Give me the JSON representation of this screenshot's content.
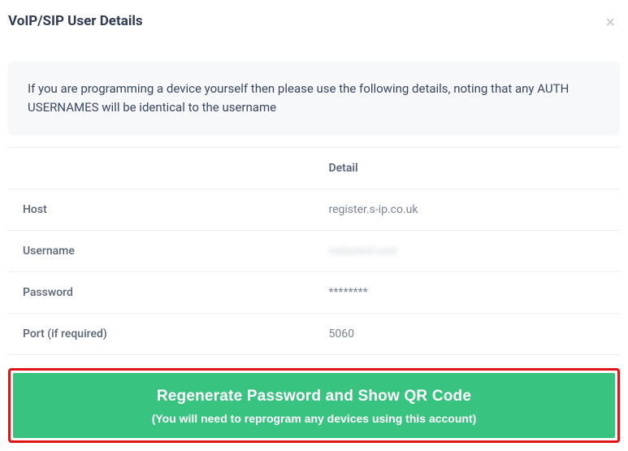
{
  "modal": {
    "title": "VoIP/SIP User Details",
    "close_label": "×"
  },
  "info": {
    "text": "If you are programming a device yourself then please use the following details, noting that any AUTH USERNAMES will be identical to the username"
  },
  "table": {
    "header_blank": "",
    "header_detail": "Detail",
    "rows": {
      "host": {
        "label": "Host",
        "value": "register.s-ip.co.uk"
      },
      "username": {
        "label": "Username",
        "value": "redacted-user"
      },
      "password": {
        "label": "Password",
        "value": "********"
      },
      "port": {
        "label": "Port (if required)",
        "value": "5060"
      }
    }
  },
  "regenerate": {
    "main": "Regenerate Password and Show QR Code",
    "sub": "(You will need to reprogram any devices using this account)"
  }
}
